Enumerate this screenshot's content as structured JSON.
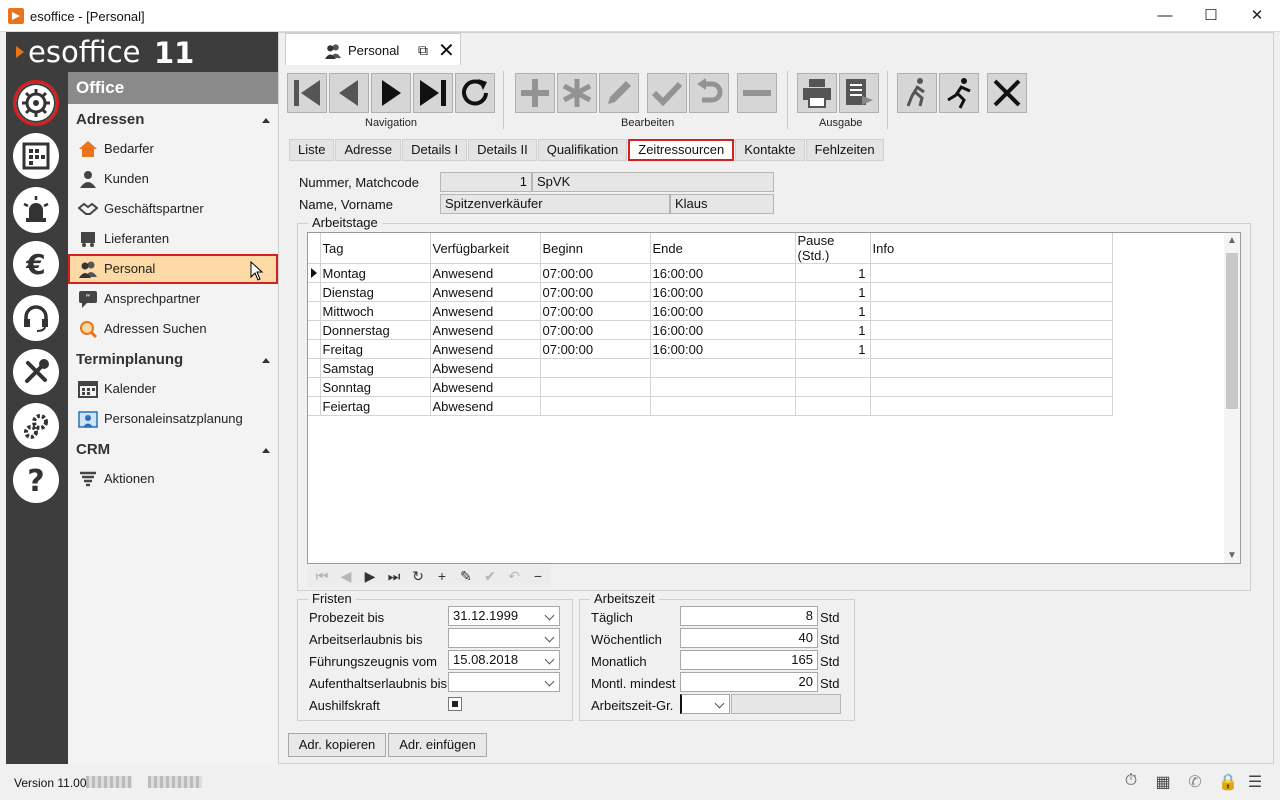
{
  "window": {
    "title": "esoffice - [Personal]",
    "minimize": "—",
    "maximize": "☐",
    "close": "✕"
  },
  "brand": {
    "name": "esoffice",
    "version": "11"
  },
  "nav": {
    "header": "Office",
    "sections": [
      {
        "title": "Adressen",
        "items": [
          "Bedarfer",
          "Kunden",
          "Geschäftspartner",
          "Lieferanten",
          "Personal",
          "Ansprechpartner",
          "Adressen Suchen"
        ]
      },
      {
        "title": "Terminplanung",
        "items": [
          "Kalender",
          "Personaleinsatzplanung"
        ]
      },
      {
        "title": "CRM",
        "items": [
          "Aktionen"
        ]
      }
    ],
    "selected": "Personal"
  },
  "rail_icons": [
    "office-wheel-icon",
    "planner-icon",
    "alarm-icon",
    "euro-icon",
    "headset-icon",
    "tools-icon",
    "settings-gears-icon",
    "help-icon"
  ],
  "doc_tab": {
    "label": "Personal"
  },
  "toolbar": {
    "groups": {
      "navigation": "Navigation",
      "bearbeiten": "Bearbeiten",
      "ausgabe": "Ausgabe"
    }
  },
  "tabs": [
    "Liste",
    "Adresse",
    "Details I",
    "Details II",
    "Qualifikation",
    "Zeitressourcen",
    "Kontakte",
    "Fehlzeiten"
  ],
  "active_tab": "Zeitressourcen",
  "header_fields": {
    "nummer_label": "Nummer, Matchcode",
    "nummer": "1",
    "matchcode": "SpVK",
    "name_label": "Name, Vorname",
    "name": "Spitzenverkäufer",
    "vorname": "Klaus"
  },
  "arbeitstage": {
    "title": "Arbeitstage",
    "columns": [
      "Tag",
      "Verfügbarkeit",
      "Beginn",
      "Ende",
      "Pause (Std.)",
      "Info"
    ],
    "rows": [
      [
        "Montag",
        "Anwesend",
        "07:00:00",
        "16:00:00",
        "1",
        ""
      ],
      [
        "Dienstag",
        "Anwesend",
        "07:00:00",
        "16:00:00",
        "1",
        ""
      ],
      [
        "Mittwoch",
        "Anwesend",
        "07:00:00",
        "16:00:00",
        "1",
        ""
      ],
      [
        "Donnerstag",
        "Anwesend",
        "07:00:00",
        "16:00:00",
        "1",
        ""
      ],
      [
        "Freitag",
        "Anwesend",
        "07:00:00",
        "16:00:00",
        "1",
        ""
      ],
      [
        "Samstag",
        "Abwesend",
        "",
        "",
        "",
        ""
      ],
      [
        "Sonntag",
        "Abwesend",
        "",
        "",
        "",
        ""
      ],
      [
        "Feiertag",
        "Abwesend",
        "",
        "",
        "",
        ""
      ]
    ]
  },
  "fristen": {
    "title": "Fristen",
    "probezeit_label": "Probezeit bis",
    "probezeit": "31.12.1999",
    "arbeitserlaubnis_label": "Arbeitserlaubnis bis",
    "arbeitserlaubnis": "",
    "fuehrungszeugnis_label": "Führungszeugnis vom",
    "fuehrungszeugnis": "15.08.2018",
    "aufenthalt_label": "Aufenthaltserlaubnis bis",
    "aufenthalt": "",
    "aushilfskraft_label": "Aushilfskraft"
  },
  "arbeitszeit": {
    "title": "Arbeitszeit",
    "taeglich_label": "Täglich",
    "taeglich": "8",
    "woechentlich_label": "Wöchentlich",
    "woechentlich": "40",
    "monatlich_label": "Monatlich",
    "monatlich": "165",
    "mindest_label": "Montl. mindest",
    "mindest": "20",
    "unit": "Std",
    "gruppe_label": "Arbeitszeit-Gr."
  },
  "buttons": {
    "kopieren": "Adr. kopieren",
    "einfuegen": "Adr. einfügen"
  },
  "status": {
    "version": "Version 11.00"
  }
}
